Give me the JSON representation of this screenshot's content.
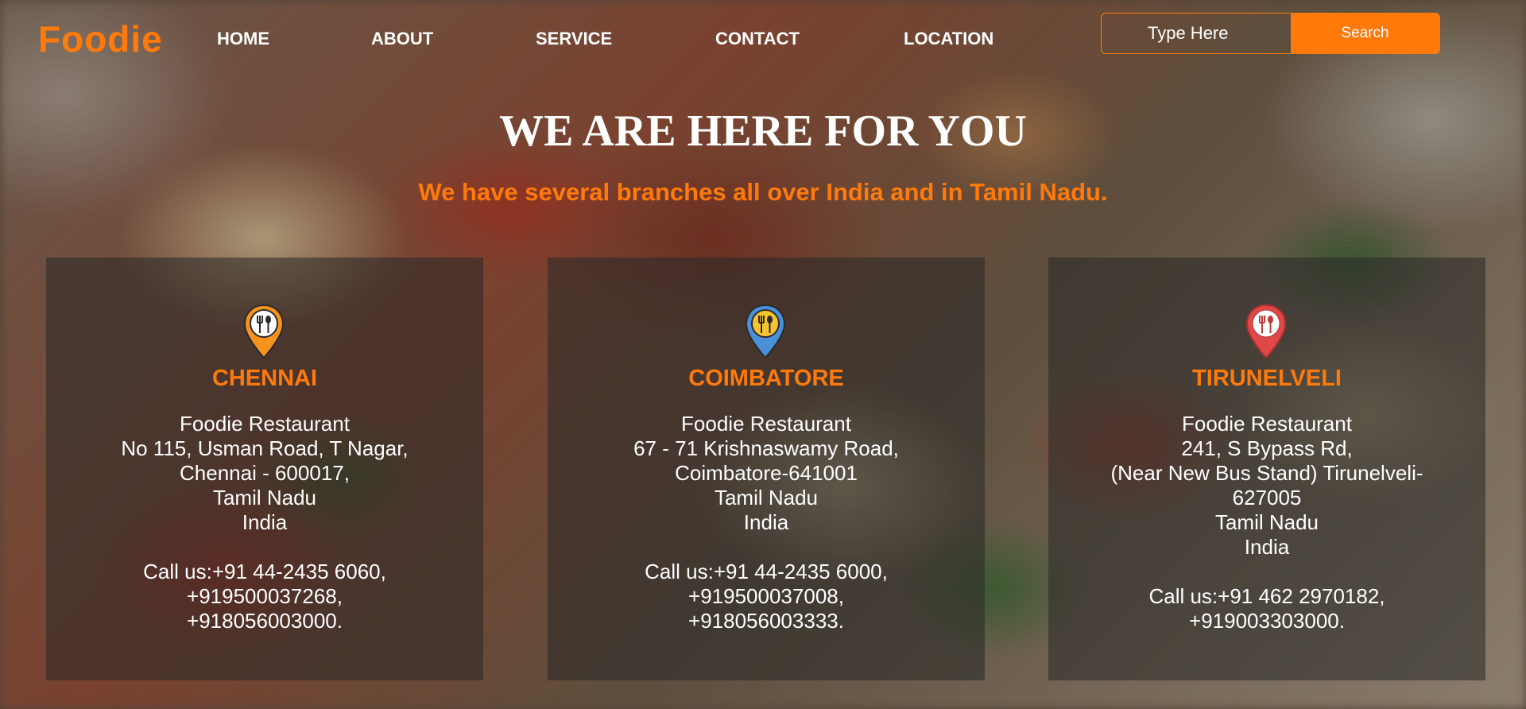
{
  "brand": {
    "logo": "Foodie",
    "accent_color": "#ff7a0b"
  },
  "nav": {
    "items": [
      {
        "label": "HOME"
      },
      {
        "label": "ABOUT"
      },
      {
        "label": "SERVICE"
      },
      {
        "label": "CONTACT"
      },
      {
        "label": "LOCATION"
      }
    ]
  },
  "search": {
    "placeholder": "Type Here",
    "button_label": "Search"
  },
  "hero": {
    "title": "WE ARE HERE FOR YOU",
    "subtitle": "We have several branches all over India and in Tamil Nadu."
  },
  "locations": [
    {
      "city": "CHENNAI",
      "pin_icon": "location-pin-restaurant-icon",
      "pin_color": "#f6921e",
      "address_lines": [
        "Foodie Restaurant",
        "No 115, Usman Road, T Nagar,",
        "Chennai - 600017,",
        "Tamil Nadu",
        "India"
      ],
      "phone_lines": [
        "Call us:+91 44-2435 6060,",
        "+919500037268,",
        "+918056003000."
      ]
    },
    {
      "city": "COIMBATORE",
      "pin_icon": "location-pin-restaurant-icon",
      "pin_color": "#4a90d9",
      "address_lines": [
        "Foodie Restaurant",
        "67 - 71 Krishnaswamy Road,",
        "Coimbatore-641001",
        "Tamil Nadu",
        "India"
      ],
      "phone_lines": [
        "Call us:+91 44-2435 6000,",
        "+919500037008,",
        "+918056003333."
      ]
    },
    {
      "city": "TIRUNELVELI",
      "pin_icon": "location-pin-restaurant-icon",
      "pin_color": "#e04848",
      "address_lines": [
        "Foodie Restaurant",
        "241, S Bypass Rd,",
        "(Near New Bus Stand) Tirunelveli-",
        "627005",
        "Tamil Nadu",
        "India"
      ],
      "phone_lines": [
        "Call us:+91 462 2970182,",
        "+919003303000."
      ]
    }
  ]
}
